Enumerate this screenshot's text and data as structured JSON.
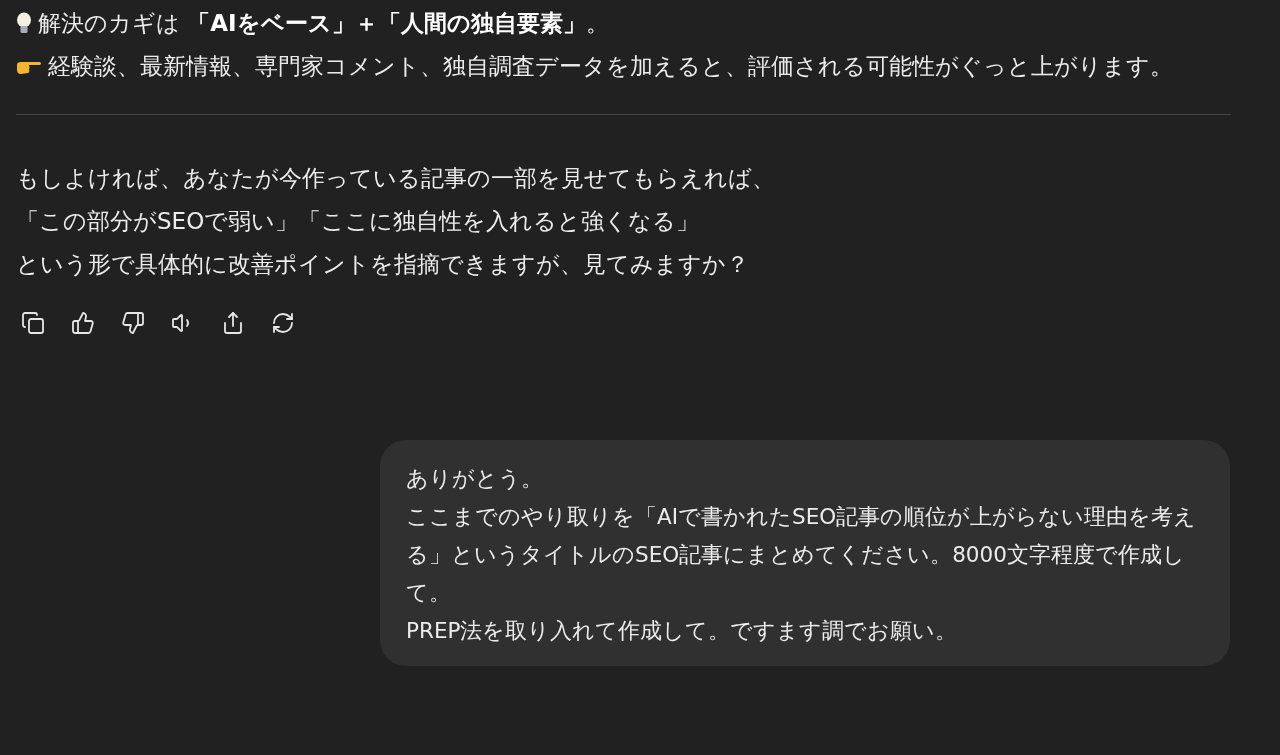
{
  "assistant_message": {
    "key_point": "解決のカギは **「AIをベース」＋「人間の独自要素」**。",
    "tip": "経験談、最新情報、専門家コメント、独自調査データを加えると、評価される可能性がぐっと上がります。",
    "closing_lines": [
      "もしよければ、あなたが今作っている記事の一部を見せてもらえれば、",
      "「この部分がSEOで弱い」「ここに独自性を入れると強くなる」",
      "という形で具体的に改善ポイントを指摘できますが、見てみますか？"
    ],
    "actions": [
      {
        "kind": "copy"
      },
      {
        "kind": "like"
      },
      {
        "kind": "dislike"
      },
      {
        "kind": "read_aloud"
      },
      {
        "kind": "share"
      },
      {
        "kind": "regenerate"
      }
    ]
  },
  "user_message": {
    "lines": [
      "ありがとう。",
      "ここまでのやり取りを「AIで書かれたSEO記事の順位が上がらない理由を考える」というタイトルのSEO記事にまとめてください。8000文字程度で作成して。",
      "PREP法を取り入れて作成して。ですます調でお願い。"
    ]
  }
}
